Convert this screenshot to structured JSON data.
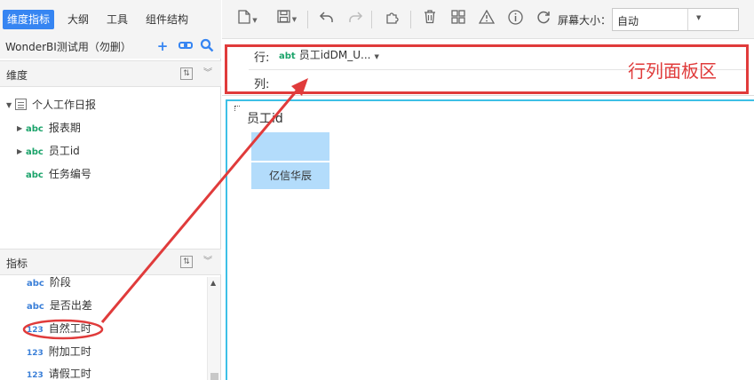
{
  "left_tabs": [
    {
      "label": "维度指标",
      "active": true
    },
    {
      "label": "大纲",
      "active": false
    },
    {
      "label": "工具",
      "active": false
    },
    {
      "label": "组件结构",
      "active": false
    }
  ],
  "package_name": "WonderBI测试用（勿删）",
  "package_icons": [
    "plus-icon",
    "link-icon",
    "search-icon"
  ],
  "dimension_section": {
    "title": "维度",
    "table": "个人工作日报",
    "fields": [
      {
        "type": "abc",
        "label": "报表期",
        "expandable": true
      },
      {
        "type": "abc",
        "label": "员工id",
        "expandable": true
      },
      {
        "type": "abc",
        "label": "任务编号",
        "expandable": false
      }
    ]
  },
  "measure_section": {
    "title": "指标",
    "fields": [
      {
        "type": "abc",
        "label": "阶段"
      },
      {
        "type": "abc",
        "label": "是否出差"
      },
      {
        "type": "123",
        "label": "自然工时"
      },
      {
        "type": "123",
        "label": "附加工时"
      },
      {
        "type": "123",
        "label": "请假工时"
      }
    ]
  },
  "toolbar": {
    "icons": [
      "new-file-icon",
      "save-icon",
      "undo-icon",
      "redo-icon",
      "puzzle-icon",
      "delete-icon",
      "layout-icon",
      "warning-icon",
      "info-icon",
      "refresh-icon"
    ],
    "screen_size_label": "屏幕大小：",
    "screen_size_value": "自动"
  },
  "row_col_panel": {
    "row_label": "行:",
    "col_label": "列:",
    "row_field_tag": "abt",
    "row_field": "员工idDM_U...",
    "annotation": "行列面板区"
  },
  "canvas": {
    "component_title": "员工id",
    "cell_value": "亿信华辰"
  },
  "colors": {
    "accent": "#3685f2",
    "annotation_red": "#e03b3b",
    "table_cell": "#b3dcfb",
    "text_tag_green": "#1aa36a",
    "number_tag_blue": "#3a7fd8"
  }
}
